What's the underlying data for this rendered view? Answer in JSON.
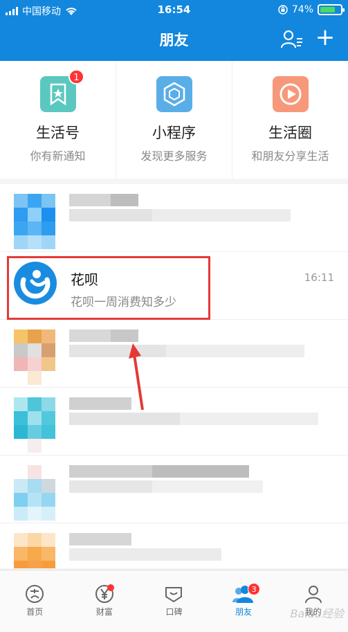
{
  "status": {
    "carrier": "中国移动",
    "time": "16:54",
    "battery": "74%",
    "battery_level": 0.74
  },
  "nav": {
    "title": "朋友"
  },
  "tiles": [
    {
      "title": "生活号",
      "sub": "你有新通知",
      "badge": "1",
      "icon": "bookmark-star-icon",
      "color": "#5bc8c0"
    },
    {
      "title": "小程序",
      "sub": "发现更多服务",
      "icon": "mini-program-icon",
      "color": "#5aaee8"
    },
    {
      "title": "生活圈",
      "sub": "和朋友分享生活",
      "icon": "play-circle-icon",
      "color": "#f7987a"
    }
  ],
  "messages": {
    "highlight": {
      "title": "花呗",
      "sub": "花呗一周消费知多少",
      "time": "16:11"
    }
  },
  "tabs": [
    {
      "label": "首页",
      "icon": "alipay-icon"
    },
    {
      "label": "财富",
      "icon": "yen-icon",
      "dot": true
    },
    {
      "label": "口碑",
      "icon": "koubei-icon"
    },
    {
      "label": "朋友",
      "icon": "friends-icon",
      "badge": "3",
      "active": true
    },
    {
      "label": "我的",
      "icon": "person-icon"
    }
  ],
  "watermark": "Baidu经验"
}
